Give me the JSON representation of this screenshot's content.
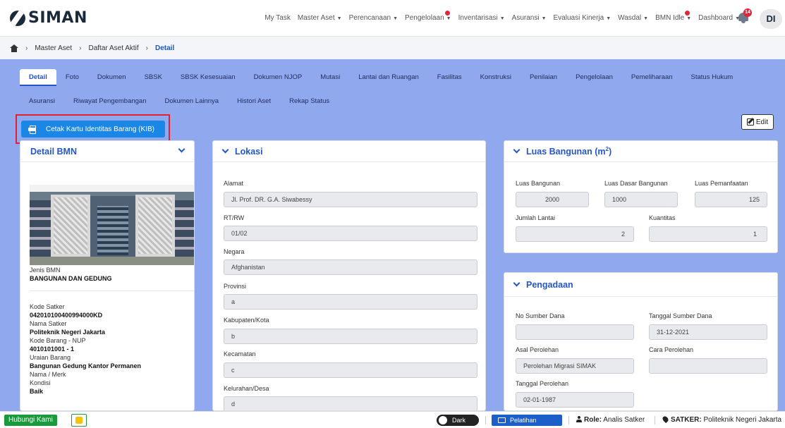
{
  "brand": {
    "name": "SIMAN"
  },
  "topnav": [
    {
      "label": "My Task",
      "caret": false,
      "dot": false
    },
    {
      "label": "Master Aset",
      "caret": true,
      "dot": false
    },
    {
      "label": "Perencanaan",
      "caret": true,
      "dot": false
    },
    {
      "label": "Pengelolaan",
      "caret": true,
      "dot": true
    },
    {
      "label": "Inventarisasi",
      "caret": true,
      "dot": false
    },
    {
      "label": "Asuransi",
      "caret": true,
      "dot": false
    },
    {
      "label": "Evaluasi Kinerja",
      "caret": true,
      "dot": false
    },
    {
      "label": "Wasdal",
      "caret": true,
      "dot": false
    },
    {
      "label": "BMN Idle",
      "caret": true,
      "dot": true
    },
    {
      "label": "Dashboard",
      "caret": true,
      "dot": false
    }
  ],
  "notifications": {
    "count": "14"
  },
  "user": {
    "initials": "DI"
  },
  "breadcrumb": {
    "item1": "Master Aset",
    "item2": "Daftar Aset Aktif",
    "current": "Detail"
  },
  "tabs_row1": [
    "Detail",
    "Foto",
    "Dokumen",
    "SBSK",
    "SBSK Kesesuaian",
    "Dokumen NJOP",
    "Mutasi",
    "Lantai dan Ruangan",
    "Fasilitas",
    "Konstruksi",
    "Penilaian",
    "Pengelolaan",
    "Pemeliharaan",
    "Status Hukum"
  ],
  "tabs_row2": [
    "Asuransi",
    "Riwayat Pengembangan",
    "Dokumen Lainnya",
    "Histori Aset",
    "Rekap Status"
  ],
  "actions": {
    "kib": "Cetak Kartu Identitas Barang (KIB)",
    "edit": "Edit"
  },
  "detail_bmn": {
    "title": "Detail BMN",
    "jenis_label": "Jenis BMN",
    "jenis_value": "BANGUNAN DAN GEDUNG",
    "kode_satker_label": "Kode Satker",
    "kode_satker_value": "042010100400994000KD",
    "nama_satker_label": "Nama Satker",
    "nama_satker_value": "Politeknik Negeri Jakarta",
    "kode_barang_label": "Kode Barang - NUP",
    "kode_barang_value": "4010101001 - 1",
    "uraian_label": "Uraian Barang",
    "uraian_value": "Bangunan Gedung Kantor Permanen",
    "nama_merk_label": "Nama / Merk",
    "kondisi_label": "Kondisi",
    "kondisi_value": "Baik"
  },
  "lokasi": {
    "title": "Lokasi",
    "alamat_label": "Alamat",
    "alamat_value": "Jl. Prof. DR. G.A. Siwabessy",
    "rtrw_label": "RT/RW",
    "rtrw_value": "01/02",
    "negara_label": "Negara",
    "negara_value": "Afghanistan",
    "provinsi_label": "Provinsi",
    "provinsi_value": "a",
    "kabkota_label": "Kabupaten/Kota",
    "kabkota_value": "b",
    "kecamatan_label": "Kecamatan",
    "kecamatan_value": "c",
    "kelurahan_label": "Kelurahan/Desa",
    "kelurahan_value": "d"
  },
  "luas": {
    "title": "Luas Bangunan (m",
    "title_sup": "2",
    "title_end": ")",
    "luas_bangunan_label": "Luas Bangunan",
    "luas_bangunan_value": "2000",
    "luas_dasar_label": "Luas Dasar Bangunan",
    "luas_dasar_value": "1000",
    "luas_pemanfaatan_label": "Luas Pemanfaatan",
    "luas_pemanfaatan_value": "125",
    "jumlah_lantai_label": "Jumlah Lantai",
    "jumlah_lantai_value": "2",
    "kuantitas_label": "Kuantitas",
    "kuantitas_value": "1"
  },
  "pengadaan": {
    "title": "Pengadaan",
    "no_sumber_label": "No Sumber Dana",
    "no_sumber_value": "",
    "tgl_sumber_label": "Tanggal Sumber Dana",
    "tgl_sumber_value": "31-12-2021",
    "asal_label": "Asal Perolehan",
    "asal_value": "Perolehan Migrasi SIMAK",
    "cara_label": "Cara Perolehan",
    "cara_value": "",
    "tgl_perolehan_label": "Tanggal Perolehan",
    "tgl_perolehan_value": "02-01-1987"
  },
  "footer": {
    "hubungi": "Hubungi Kami",
    "dark": "Dark",
    "pelatihan": "Pelatihan",
    "role_label": "Role:",
    "role_value": "Analis Satker",
    "satker_label": "SATKER:",
    "satker_value": "Politeknik Negeri Jakarta"
  }
}
